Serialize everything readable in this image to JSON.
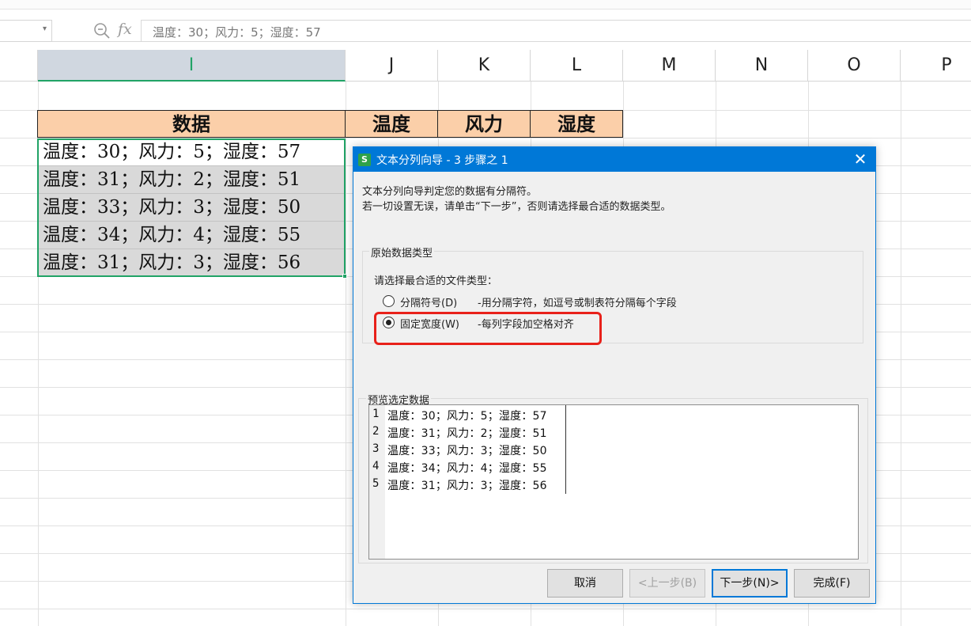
{
  "formula_bar": {
    "content": "温度：30；风力：5；湿度：57",
    "zoom_icon": "zoom-icon",
    "fx_label": "fx"
  },
  "columns": [
    "I",
    "J",
    "K",
    "L",
    "M",
    "N",
    "O",
    "P"
  ],
  "table": {
    "headers": [
      "数据",
      "温度",
      "风力",
      "湿度"
    ],
    "rows": [
      "温度：30；风力：5；湿度：57",
      "温度：31；风力：2；湿度：51",
      "温度：33；风力：3；湿度：50",
      "温度：34；风力：4；湿度：55",
      "温度：31；风力：3；湿度：56"
    ]
  },
  "dialog": {
    "icon_letter": "S",
    "title": "文本分列向导 - 3 步骤之 1",
    "intro_line1": "文本分列向导判定您的数据有分隔符。",
    "intro_line2": "若一切设置无误，请单击“下一步”，否则请选择最合适的数据类型。",
    "group_original": "原始数据类型",
    "choose_label": "请选择最合适的文件类型：",
    "option_delimited": {
      "label": "分隔符号(D)",
      "desc": "-用分隔字符，如逗号或制表符分隔每个字段",
      "checked": false
    },
    "option_fixed": {
      "label": "固定宽度(W)",
      "desc": "-每列字段加空格对齐",
      "checked": true
    },
    "preview_title": "预览选定数据",
    "preview_rows": [
      {
        "num": "1",
        "text": "温度：30；风力：5；湿度：57"
      },
      {
        "num": "2",
        "text": "温度：31；风力：2；湿度：51"
      },
      {
        "num": "3",
        "text": "温度：33；风力：3；湿度：50"
      },
      {
        "num": "4",
        "text": "温度：34；风力：4；湿度：55"
      },
      {
        "num": "5",
        "text": "温度：31；风力：3；湿度：56"
      }
    ],
    "buttons": {
      "cancel": "取消",
      "back": "<上一步(B)",
      "next": "下一步(N)>",
      "finish": "完成(F)"
    }
  },
  "colors": {
    "accent_green": "#21a366",
    "title_blue": "#0078d7",
    "header_fill": "#fbcfa9",
    "highlight_red": "#e8211a"
  }
}
